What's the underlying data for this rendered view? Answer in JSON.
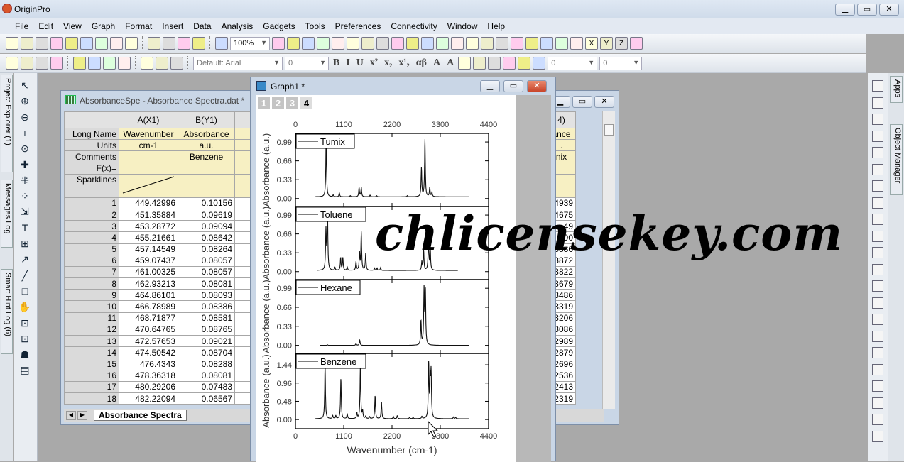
{
  "app": {
    "title": "OriginPro",
    "window_controls": [
      "minimize",
      "restore",
      "close"
    ]
  },
  "menu": [
    "File",
    "Edit",
    "View",
    "Graph",
    "Format",
    "Insert",
    "Data",
    "Analysis",
    "Gadgets",
    "Tools",
    "Preferences",
    "Connectivity",
    "Window",
    "Help"
  ],
  "toolbar1": {
    "icons_left": [
      "new-project-icon",
      "new-folder-icon",
      "new-workbook-icon",
      "new-graph-icon",
      "new-matrix-icon",
      "new-function-icon",
      "new-layout-icon",
      "new-notes-icon",
      "new-excel-icon",
      "open-icon",
      "open-template-icon",
      "save-icon",
      "save-template-icon",
      "recalculate-icon"
    ],
    "zoom": "100%",
    "icons_right": [
      "print-icon",
      "slideshow-icon",
      "export-icon",
      "film-icon",
      "script-window-icon",
      "command-window-icon",
      "results-log-icon",
      "project-tree-icon",
      "find-icon",
      "code-builder-icon",
      "worksheet-icon",
      "notes-icon",
      "add-layer-icon",
      "sum-icon",
      "stats-icon",
      "bar-plot-icon",
      "column-plot-icon",
      "histogram-icon",
      "filter-icon",
      "clear-filter-icon",
      "sort-icon",
      "x-icon",
      "y-icon",
      "z-icon",
      "none-icon"
    ],
    "axis_labels": [
      "X",
      "Y",
      "Z"
    ]
  },
  "toolbar2": {
    "icons_left": [
      "import-wizard-icon",
      "import-single-ascii-icon",
      "import-multiple-ascii-icon",
      "import-excel-icon",
      "add-column-icon",
      "move-column-icon",
      "set-column-icon",
      "duplicate-icon",
      "cut-icon",
      "copy-icon",
      "paste-icon"
    ],
    "font": "Default: Arial",
    "font_size": "0",
    "format_buttons": [
      "B",
      "I",
      "U",
      "x²",
      "x₂",
      "x¹₂",
      "αβ",
      "A",
      "A"
    ],
    "line_width": "0",
    "line_width2": "0"
  },
  "left_dock": [
    "Project Explorer (1)",
    "Messages Log",
    "Smart Hint Log (6)"
  ],
  "right_dock": [
    "Apps",
    "Object Manager"
  ],
  "left_tools": [
    "pointer-icon",
    "zoom-in-icon",
    "zoom-out-icon",
    "screen-reader-icon",
    "data-reader-icon",
    "data-cursor-icon",
    "data-selector-icon",
    "mask-icon",
    "scale-icon",
    "text-tool-icon",
    "insert-table-icon",
    "arrow-tool-icon",
    "line-tool-icon",
    "rectangle-tool-icon",
    "pan-icon",
    "insert-graph-icon",
    "insert-image-icon",
    "hand-icon",
    "layer-icon"
  ],
  "worksheet": {
    "title": "AbsorbanceSpe - Absorbance Spectra.dat *",
    "columns": [
      "A(X1)",
      "B(Y1)",
      "4)"
    ],
    "row_labels": [
      "Long Name",
      "Units",
      "Comments",
      "F(x)=",
      "Sparklines"
    ],
    "long_names": [
      "Wavenumber",
      "Absorbance",
      "Wa",
      "ance"
    ],
    "units": [
      "cm-1",
      "a.u.",
      "."
    ],
    "comments": [
      "",
      "Benzene",
      "nix"
    ],
    "rows": [
      [
        "1",
        "449.42996",
        "0.10156",
        "4939"
      ],
      [
        "2",
        "451.35884",
        "0.09619",
        "4675"
      ],
      [
        "3",
        "453.28772",
        "0.09094",
        "49"
      ],
      [
        "4",
        "455.21661",
        "0.08642",
        "90"
      ],
      [
        "5",
        "457.14549",
        "0.08264",
        "3886"
      ],
      [
        "6",
        "459.07437",
        "0.08057",
        "3872"
      ],
      [
        "7",
        "461.00325",
        "0.08057",
        "3822"
      ],
      [
        "8",
        "462.93213",
        "0.08081",
        "3679"
      ],
      [
        "9",
        "464.86101",
        "0.08093",
        "3486"
      ],
      [
        "10",
        "466.78989",
        "0.08386",
        "3319"
      ],
      [
        "11",
        "468.71877",
        "0.08581",
        "3206"
      ],
      [
        "12",
        "470.64765",
        "0.08765",
        "3086"
      ],
      [
        "13",
        "472.57653",
        "0.09021",
        "2989"
      ],
      [
        "14",
        "474.50542",
        "0.08704",
        "2879"
      ],
      [
        "15",
        "476.4343",
        "0.08288",
        "2696"
      ],
      [
        "16",
        "478.36318",
        "0.08081",
        "2536"
      ],
      [
        "17",
        "480.29206",
        "0.07483",
        "2413"
      ],
      [
        "18",
        "482.22094",
        "0.06567",
        "2319"
      ]
    ],
    "sheet_tab": "Absorbance Spectra"
  },
  "graph": {
    "title": "Graph1 *",
    "page_tabs": [
      "1",
      "2",
      "3",
      "4"
    ],
    "active_tab": "4"
  },
  "watermark": "chlicensekey.com",
  "chart_data": {
    "type": "line",
    "layout": "4 stacked panels sharing x axis",
    "xlabel": "Wavenumber (cm-1)",
    "xlim": [
      0,
      4400
    ],
    "xticks": [
      "0",
      "1100",
      "2200",
      "3300",
      "4400"
    ],
    "panels": [
      {
        "name": "Tumix",
        "ylabel": "Absorbance (a.u.)",
        "ylim": [
          -0.14,
          1.14
        ],
        "yticks": [
          "0.00",
          "0.33",
          "0.66",
          "0.99"
        ],
        "x_range": [
          450,
          3950
        ],
        "baseline": 0.03,
        "peaks": [
          [
            700,
            1.05
          ],
          [
            860,
            0.03
          ],
          [
            1000,
            0.07
          ],
          [
            1250,
            0.02
          ],
          [
            1450,
            0.16
          ],
          [
            1500,
            0.16
          ],
          [
            1700,
            0.03
          ],
          [
            1850,
            0.02
          ],
          [
            2550,
            0.02
          ],
          [
            2870,
            0.5
          ],
          [
            2950,
            1.0
          ],
          [
            3060,
            0.16
          ],
          [
            3110,
            0.08
          ]
        ]
      },
      {
        "name": "Toluene",
        "ylabel": "Absorbance (a.u.)",
        "ylim": [
          -0.14,
          1.14
        ],
        "yticks": [
          "0.00",
          "0.33",
          "0.66",
          "0.99"
        ],
        "x_range": [
          500,
          3700
        ],
        "baseline": 0.02,
        "peaks": [
          [
            695,
            0.7
          ],
          [
            730,
            1.05
          ],
          [
            900,
            0.05
          ],
          [
            1030,
            0.22
          ],
          [
            1080,
            0.22
          ],
          [
            1180,
            0.06
          ],
          [
            1380,
            0.15
          ],
          [
            1460,
            0.3
          ],
          [
            1500,
            0.66
          ],
          [
            1600,
            0.3
          ],
          [
            1800,
            0.04
          ],
          [
            1860,
            0.04
          ],
          [
            1940,
            0.05
          ],
          [
            2880,
            0.15
          ],
          [
            2920,
            0.35
          ],
          [
            3030,
            0.55
          ],
          [
            3070,
            0.4
          ]
        ]
      },
      {
        "name": "Hexane",
        "ylabel": "Absorbance (a.u.)",
        "ylim": [
          -0.14,
          1.14
        ],
        "yticks": [
          "0.00",
          "0.33",
          "0.66",
          "0.99"
        ],
        "x_range": [
          550,
          3950
        ],
        "baseline": 0.0,
        "peaks": [
          [
            730,
            0.01
          ],
          [
            1380,
            0.03
          ],
          [
            1465,
            0.09
          ],
          [
            2860,
            0.42
          ],
          [
            2930,
            0.95
          ],
          [
            2960,
            0.93
          ]
        ]
      },
      {
        "name": "Benzene",
        "ylabel": "Absorbance (a.u.)",
        "ylim": [
          -0.24,
          1.74
        ],
        "yticks": [
          "0.00",
          "0.48",
          "0.96",
          "1.44"
        ],
        "x_range": [
          450,
          3950
        ],
        "baseline": 0.02,
        "peaks": [
          [
            675,
            1.44
          ],
          [
            850,
            0.08
          ],
          [
            920,
            0.08
          ],
          [
            1035,
            1.05
          ],
          [
            1180,
            0.13
          ],
          [
            1400,
            0.15
          ],
          [
            1480,
            1.44
          ],
          [
            1530,
            0.2
          ],
          [
            1600,
            0.06
          ],
          [
            1690,
            0.05
          ],
          [
            1815,
            0.6
          ],
          [
            1960,
            0.45
          ],
          [
            2230,
            0.06
          ],
          [
            2320,
            0.08
          ],
          [
            2600,
            0.04
          ],
          [
            2680,
            0.04
          ],
          [
            2880,
            0.06
          ],
          [
            3035,
            1.44
          ],
          [
            3070,
            0.95
          ],
          [
            3090,
            1.15
          ],
          [
            3600,
            0.05
          ],
          [
            3650,
            0.04
          ]
        ]
      }
    ]
  }
}
